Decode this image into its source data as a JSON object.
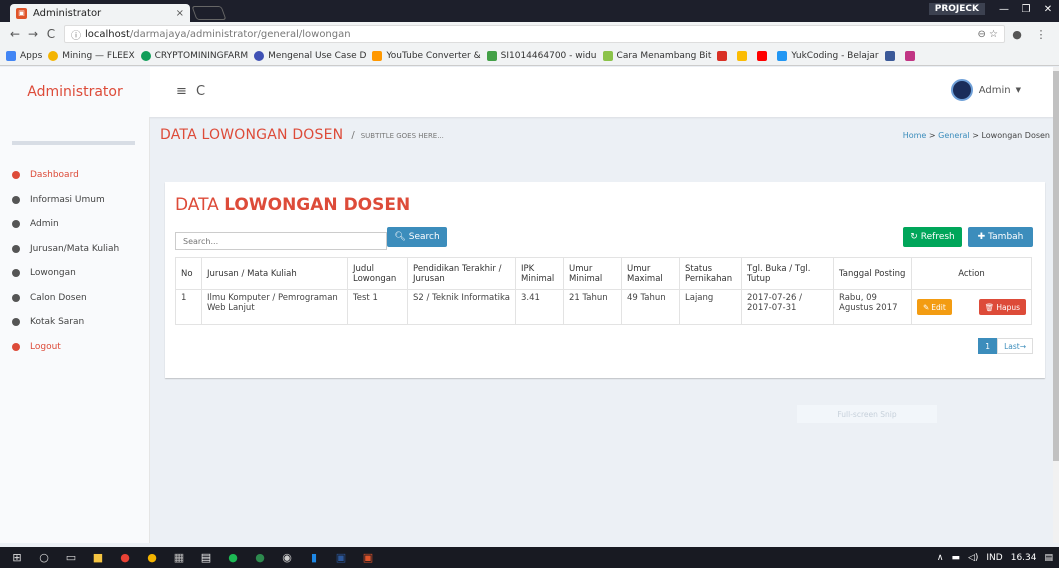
{
  "browser": {
    "tab_title": "Administrator",
    "tab_close": "×",
    "profile": "PROJECK",
    "url_host": "localhost",
    "url_path": "/darmajaya/administrator/general/lowongan",
    "bookmarks": [
      {
        "label": "Apps",
        "color": "#4285f4"
      },
      {
        "label": "Mining — FLEEX",
        "color": "#f4b400"
      },
      {
        "label": "CRYPTOMININGFARM",
        "color": "#0f9d58"
      },
      {
        "label": "Mengenal Use Case D",
        "color": "#3f51b5"
      },
      {
        "label": "YouTube Converter &",
        "color": "#ff9800"
      },
      {
        "label": "SI1014464700 - widu",
        "color": "#43a047"
      },
      {
        "label": "Cara Menambang Bit",
        "color": "#8bc34a"
      },
      {
        "label": "YukCoding - Belajar",
        "color": "#2196f3"
      }
    ]
  },
  "header": {
    "brand": "Administrator",
    "user": "Admin"
  },
  "sidebar": {
    "items": [
      {
        "label": "Dashboard",
        "active": true
      },
      {
        "label": "Informasi Umum"
      },
      {
        "label": "Admin"
      },
      {
        "label": "Jurusan/Mata Kuliah"
      },
      {
        "label": "Lowongan"
      },
      {
        "label": "Calon Dosen"
      },
      {
        "label": "Kotak Saran"
      },
      {
        "label": "Logout",
        "active": true
      }
    ]
  },
  "content_header": {
    "title": "DATA LOWONGAN DOSEN",
    "separator": "/",
    "subtitle": "SUBTITLE GOES HERE...",
    "breadcrumb": {
      "home": "Home",
      "sep": ">",
      "general": "General",
      "current": "Lowongan Dosen"
    }
  },
  "box": {
    "title_prefix": "DATA ",
    "title_bold": "LOWONGAN DOSEN",
    "search_placeholder": "Search...",
    "search_button": "Search",
    "refresh_button": "Refresh",
    "add_button": "Tambah"
  },
  "table": {
    "headers": [
      "No",
      "Jurusan / Mata Kuliah",
      "Judul Lowongan",
      "Pendidikan Terakhir / Jurusan",
      "IPK Minimal",
      "Umur Minimal",
      "Umur Maximal",
      "Status Pernikahan",
      "Tgl. Buka / Tgl. Tutup",
      "Tanggal Posting",
      "Action"
    ],
    "rows": [
      {
        "no": "1",
        "jurusan": "Ilmu Komputer / Pemrograman Web Lanjut",
        "judul": "Test 1",
        "pendidikan": "S2 / Teknik Informatika",
        "ipk": "3.41",
        "umur_min": "21 Tahun",
        "umur_max": "49 Tahun",
        "status": "Lajang",
        "tgl": "2017-07-26 / 2017-07-31",
        "posting": "Rabu, 09 Agustus 2017",
        "edit": "Edit",
        "hapus": "Hapus"
      }
    ]
  },
  "pagination": {
    "current": "1",
    "last": "Last→"
  },
  "overlay": {
    "snip": "Full-screen Snip"
  },
  "taskbar": {
    "lang": "IND",
    "time": "16.34"
  }
}
